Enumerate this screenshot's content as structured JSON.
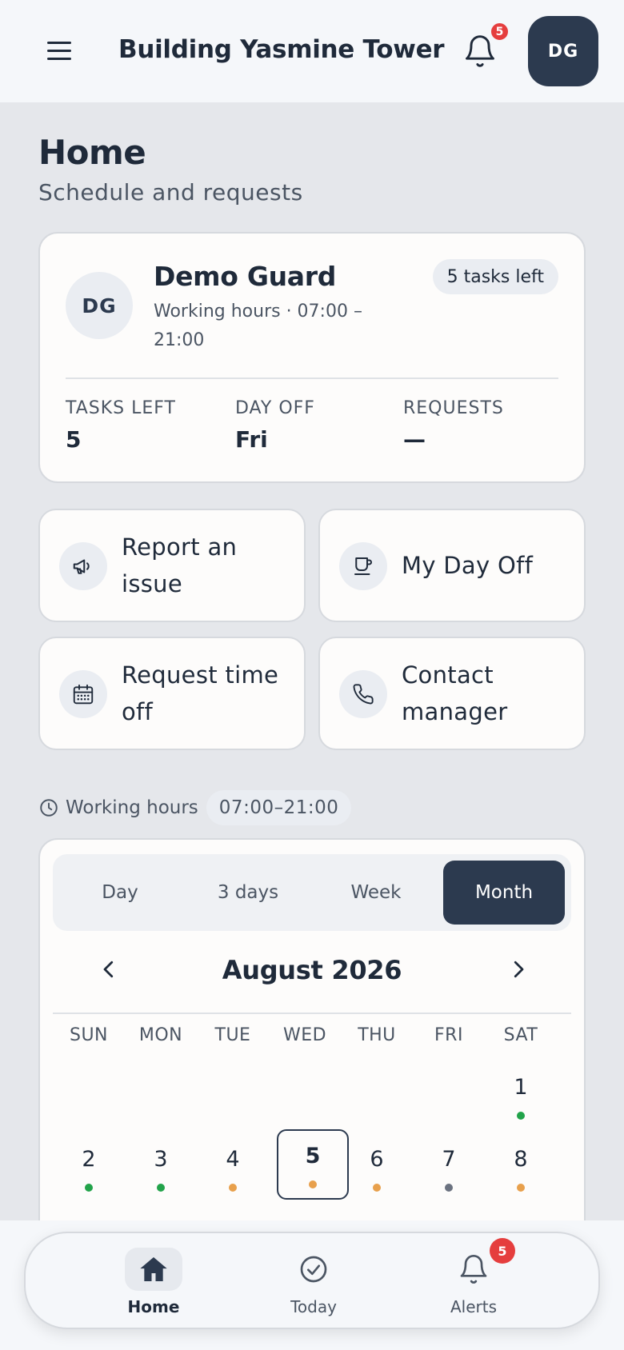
{
  "header": {
    "title": "Building Yasmine Tower",
    "notification_count": "5",
    "avatar_initials": "DG"
  },
  "page": {
    "title": "Home",
    "subtitle": "Schedule and requests"
  },
  "profile": {
    "initials": "DG",
    "name": "Demo Guard",
    "hours_text": "Working hours · 07:00 – 21:00",
    "tasks_pill": "5 tasks left",
    "stats": [
      {
        "label": "TASKS LEFT",
        "value": "5"
      },
      {
        "label": "DAY OFF",
        "value": "Fri"
      },
      {
        "label": "REQUESTS",
        "value": "—"
      }
    ]
  },
  "actions": [
    {
      "label": "Report an issue",
      "icon": "megaphone-icon"
    },
    {
      "label": "My Day Off",
      "icon": "coffee-cup-icon"
    },
    {
      "label": "Request time off",
      "icon": "calendar-icon"
    },
    {
      "label": "Contact manager",
      "icon": "phone-icon"
    }
  ],
  "working_hours": {
    "label": "Working hours",
    "value": "07:00–21:00"
  },
  "calendar": {
    "views": [
      "Day",
      "3 days",
      "Week",
      "Month"
    ],
    "active_view": "Month",
    "month_label": "August 2026",
    "weekdays": [
      "SUN",
      "MON",
      "TUE",
      "WED",
      "THU",
      "FRI",
      "SAT"
    ],
    "selected_day": "5",
    "colors": {
      "green": "#22a34a",
      "orange": "#e8a04c",
      "gray": "#6b7280"
    },
    "days": [
      {
        "day": "1",
        "dot": "green"
      },
      {
        "day": "2",
        "dot": "green"
      },
      {
        "day": "3",
        "dot": "green"
      },
      {
        "day": "4",
        "dot": "orange"
      },
      {
        "day": "5",
        "dot": "orange"
      },
      {
        "day": "6",
        "dot": "orange"
      },
      {
        "day": "7",
        "dot": "gray"
      },
      {
        "day": "8",
        "dot": "orange"
      }
    ]
  },
  "bottom_nav": {
    "items": [
      {
        "label": "Home",
        "icon": "home-icon",
        "active": true
      },
      {
        "label": "Today",
        "icon": "check-circle-icon",
        "active": false
      },
      {
        "label": "Alerts",
        "icon": "bell-icon",
        "active": false,
        "badge": "5"
      }
    ]
  }
}
